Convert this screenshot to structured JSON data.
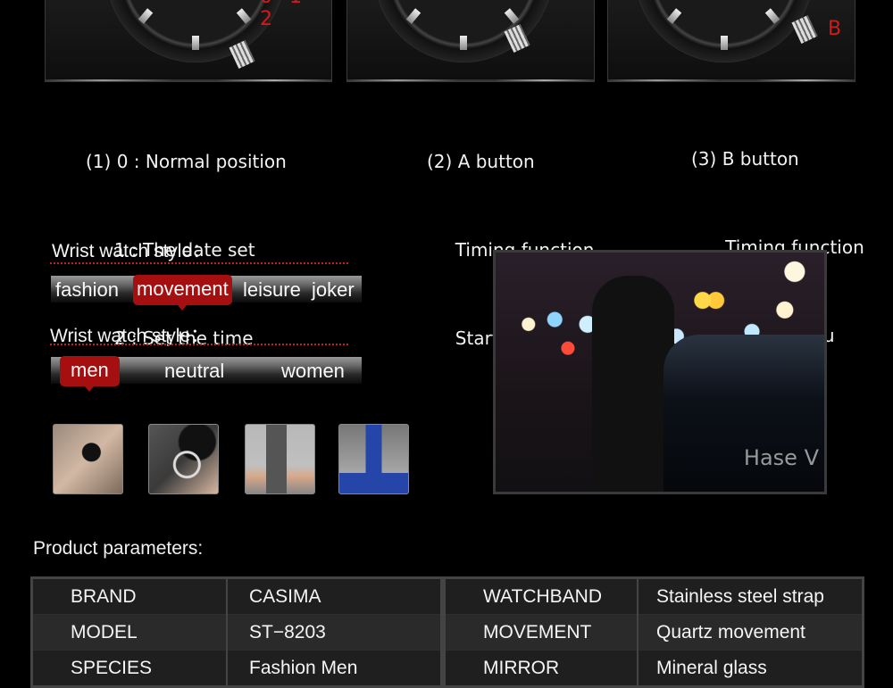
{
  "watch_panels": [
    {
      "label": "0 1 2"
    },
    {
      "label": ""
    },
    {
      "label": "B"
    }
  ],
  "instructions": [
    {
      "lines": [
        "(1) 0 : Normal position",
        "     1 : The date set",
        "     2 : Set the time"
      ]
    },
    {
      "lines": [
        "(2) A button",
        "     Timing function",
        "     Start/stop"
      ]
    },
    {
      "lines": [
        "(3) B button",
        "      Timing function",
        "       Back in situ"
      ]
    }
  ],
  "style_group_1": {
    "title": "Wrist watch style：",
    "tags": [
      {
        "label": "fashion",
        "active": false
      },
      {
        "label": "movement",
        "active": true
      },
      {
        "label": "leisure",
        "active": false
      },
      {
        "label": "joker",
        "active": false
      }
    ]
  },
  "style_group_2": {
    "title": "Wrist watch style：",
    "tags": [
      {
        "label": "men",
        "active": true
      },
      {
        "label": "neutral",
        "active": false
      },
      {
        "label": "women",
        "active": false
      }
    ]
  },
  "thumbnails": [
    {
      "icon": "loupe-inspection-image"
    },
    {
      "icon": "ring-inspection-image"
    },
    {
      "icon": "drill-press-image"
    },
    {
      "icon": "blue-press-tool-image"
    }
  ],
  "photo": {
    "watermark": "Hase V"
  },
  "params": {
    "title": "Product parameters:",
    "left": [
      {
        "key": "BRAND",
        "value": "CASIMA"
      },
      {
        "key": "MODEL",
        "value": "ST−8203"
      },
      {
        "key": "SPECIES",
        "value": "Fashion Men"
      }
    ],
    "right": [
      {
        "key": "WATCHBAND",
        "value": "Stainless steel strap"
      },
      {
        "key": "MOVEMENT",
        "value": "Quartz movement"
      },
      {
        "key": "MIRROR",
        "value": "Mineral glass"
      }
    ]
  }
}
